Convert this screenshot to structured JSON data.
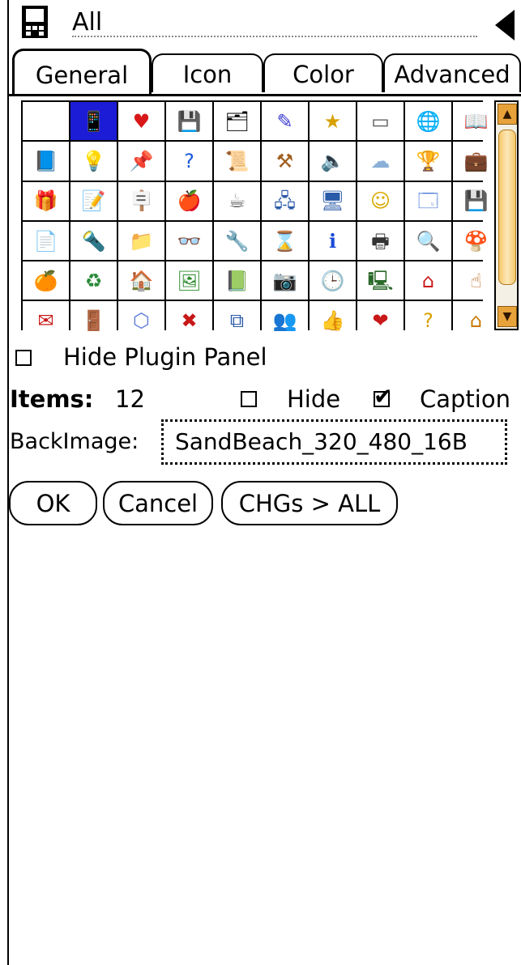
{
  "titlebar": {
    "category": "All",
    "app_icon": "handheld-device-icon",
    "back_icon": "back-arrow-icon"
  },
  "tabs": [
    {
      "label": "General",
      "active": true
    },
    {
      "label": "Icon",
      "active": false
    },
    {
      "label": "Color",
      "active": false
    },
    {
      "label": "Advanced",
      "active": false
    }
  ],
  "icon_grid": {
    "selected_index": 1,
    "icons": [
      "blank",
      "handheld-device-icon",
      "heart-icon",
      "sd-card-icon",
      "cf-card-icon",
      "stylus-icon",
      "star-icon",
      "memory-chip-icon",
      "globe-icon",
      "book-open-icon",
      "book-icon",
      "lightbulb-icon",
      "push-pin-icon",
      "help-icon",
      "scroll-icon",
      "hammer-tool-icon",
      "speaker-icon",
      "cloud-icon",
      "cup-icon",
      "briefcase-icon",
      "gift-icon",
      "notepad-icon",
      "signpost-icon",
      "apple-icon",
      "mug-icon",
      "network-icon",
      "computers-icon",
      "smiley-icon",
      "finder-icon",
      "floppy-disk-icon",
      "document-icon",
      "flashlight-icon",
      "folder-icon",
      "glasses-icon",
      "wrench-icon",
      "hourglass-icon",
      "info-icon",
      "printer-icon",
      "magnifier-icon",
      "mushroom-icon",
      "orange-icon",
      "recycle-icon",
      "house-icon",
      "picture-icon",
      "green-book-icon",
      "camera-icon",
      "clock-icon",
      "monitor-icon",
      "home-icon",
      "hand-pointer-icon",
      "mail-icon",
      "door-exit-icon",
      "cube-icon",
      "delete-x-icon",
      "copy-files-icon",
      "people-icon",
      "thumb-icon",
      "heart-red-icon",
      "question-icon",
      "small-house-icon"
    ],
    "glyphs": [
      "",
      "📱",
      "♥",
      "💾",
      "🗂",
      "✎",
      "★",
      "▭",
      "🌐",
      "📖",
      "📘",
      "💡",
      "📌",
      "?",
      "📜",
      "⚒",
      "🔈",
      "☁",
      "🏆",
      "💼",
      "🎁",
      "📝",
      "🪧",
      "🍎",
      "☕",
      "🖧",
      "🖥",
      "☺",
      "🗔",
      "💾",
      "📄",
      "🔦",
      "📁",
      "👓",
      "🔧",
      "⌛",
      "ℹ",
      "🖶",
      "🔍",
      "🍄",
      "🍊",
      "♻",
      "🏠",
      "🖼",
      "📗",
      "📷",
      "🕒",
      "🖳",
      "⌂",
      "☝",
      "✉",
      "🚪",
      "⬡",
      "✖",
      "⧉",
      "👥",
      "👍",
      "❤",
      "?",
      "⌂"
    ],
    "glyph_colors": [
      "#000",
      "#000",
      "#d81818",
      "#1a2a9a",
      "#000",
      "#3a3ad0",
      "#d8a000",
      "#555",
      "#1a6ad8",
      "#1a3a9a",
      "#1a3aa8",
      "#e8c800",
      "#333",
      "#1a5ad8",
      "#c88a30",
      "#a06020",
      "#4a5a7a",
      "#8ab0d8",
      "#3a4ad0",
      "#a86820",
      "#a01a6a",
      "#333",
      "#c87800",
      "#c81818",
      "#555",
      "#2a5aa8",
      "#2a5aa8",
      "#d8a800",
      "#4a7ad8",
      "#2a4aa8",
      "#333",
      "#2a3ab0",
      "#d8a800",
      "#333",
      "#333",
      "#1a3aa8",
      "#1a4ad8",
      "#333",
      "#2a5ad8",
      "#c81818",
      "#e88a00",
      "#2a8a3a",
      "#b85010",
      "#2a8a2a",
      "#2a7a2a",
      "#333",
      "#1a5ad8",
      "#2a6a2a",
      "#c81818",
      "#b86a20",
      "#c81818",
      "#2a7a2a",
      "#5a7ad8",
      "#c81818",
      "#2a5aa8",
      "#5a4a30",
      "#c88a60",
      "#c81818",
      "#d8a000",
      "#c87800"
    ]
  },
  "options": {
    "hide_plugin_panel": {
      "label": "Hide Plugin Panel",
      "checked": false
    },
    "items_label": "Items:",
    "items_value": "12",
    "hide": {
      "label": "Hide",
      "checked": false
    },
    "caption": {
      "label": "Caption",
      "checked": true
    },
    "check_mark": "✔"
  },
  "backimage": {
    "label": "BackImage:",
    "value": "SandBeach_320_480_16B"
  },
  "buttons": {
    "ok": "OK",
    "cancel": "Cancel",
    "chgs_all": "CHGs > ALL"
  },
  "colors": {
    "selection": "#1c1cd6",
    "scrollbar_accent": "#e8a23a"
  }
}
